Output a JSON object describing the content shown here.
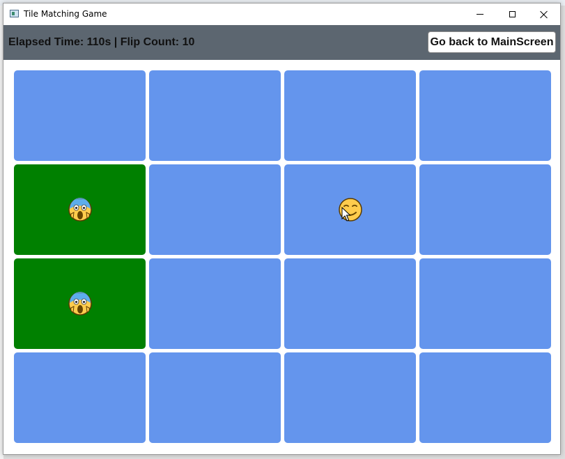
{
  "window": {
    "title": "Tile Matching Game"
  },
  "header": {
    "status": "Elapsed Time: 110s | Flip Count: 10",
    "back_button_label": "Go back to MainScreen"
  },
  "colors": {
    "header_bg": "#5c6670",
    "tile_hidden": "#6495ed",
    "tile_matched": "#008000"
  },
  "board": {
    "rows": 4,
    "cols": 4,
    "tiles": [
      {
        "state": "hidden",
        "icon": ""
      },
      {
        "state": "hidden",
        "icon": ""
      },
      {
        "state": "hidden",
        "icon": ""
      },
      {
        "state": "hidden",
        "icon": ""
      },
      {
        "state": "matched",
        "icon": "face-screaming-in-fear"
      },
      {
        "state": "hidden",
        "icon": ""
      },
      {
        "state": "revealed",
        "icon": "drooling-face"
      },
      {
        "state": "hidden",
        "icon": ""
      },
      {
        "state": "matched",
        "icon": "face-screaming-in-fear"
      },
      {
        "state": "hidden",
        "icon": ""
      },
      {
        "state": "hidden",
        "icon": ""
      },
      {
        "state": "hidden",
        "icon": ""
      },
      {
        "state": "hidden",
        "icon": ""
      },
      {
        "state": "hidden",
        "icon": ""
      },
      {
        "state": "hidden",
        "icon": ""
      },
      {
        "state": "hidden",
        "icon": ""
      }
    ]
  }
}
